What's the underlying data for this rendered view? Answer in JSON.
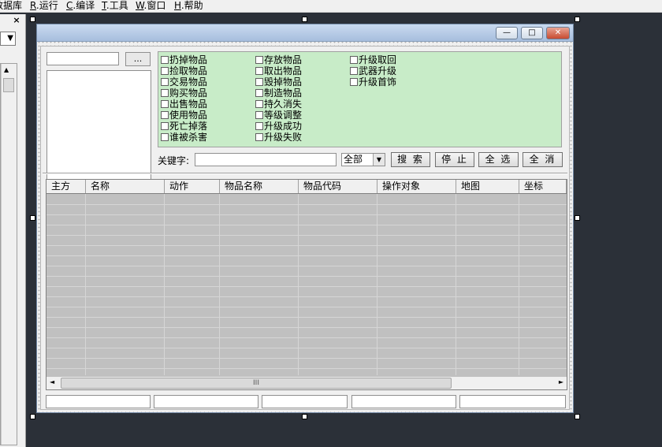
{
  "menubar": {
    "items": [
      {
        "accel": "",
        "label": "数据库"
      },
      {
        "accel": "R",
        "label": ".运行"
      },
      {
        "accel": "C",
        "label": ".编译"
      },
      {
        "accel": "T",
        "label": ".工具"
      },
      {
        "accel": "W",
        "label": ".窗口"
      },
      {
        "accel": "H",
        "label": ".帮助"
      }
    ]
  },
  "left_panel": {
    "close_glyph": "×",
    "combo_arrow": "▼",
    "scroll_up": "▲"
  },
  "window": {
    "min_glyph": "—",
    "max_glyph": "□",
    "close_glyph": "✕"
  },
  "browse_button": "...",
  "filters": {
    "col1": [
      "扔掉物品",
      "捡取物品",
      "交易物品",
      "购买物品",
      "出售物品",
      "使用物品",
      "死亡掉落",
      "谁被杀害"
    ],
    "col2": [
      "存放物品",
      "取出物品",
      "毁掉物品",
      "制造物品",
      "持久消失",
      "等级调整",
      "升级成功",
      "升级失败"
    ],
    "col3": [
      "升级取回",
      "武器升级",
      "升级首饰"
    ]
  },
  "keyword": {
    "label": "关键字:",
    "value": ""
  },
  "scope": {
    "selected": "全部",
    "arrow": "▼"
  },
  "buttons": {
    "search": "搜 索",
    "stop": "停 止",
    "select_all": "全 选",
    "cancel_all": "全 消"
  },
  "grid": {
    "columns": [
      "主方",
      "名称",
      "动作",
      "物品名称",
      "物品代码",
      "操作对象",
      "地图",
      "坐标"
    ],
    "rows": []
  },
  "hscroll": {
    "left": "◄",
    "right": "►",
    "thumb_grip": "III"
  },
  "colors": {
    "filter_bg": "#c8ecc8",
    "grid_bg": "#c0c0c0",
    "desktop": "#2b3038"
  }
}
